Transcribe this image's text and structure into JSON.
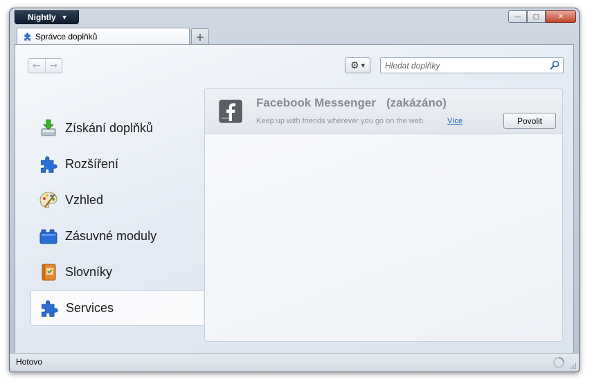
{
  "window": {
    "app_menu_label": "Nightly",
    "controls": {
      "minimize": "—",
      "maximize": "▢",
      "close": "✕"
    }
  },
  "tabs": [
    {
      "label": "Správce doplňků"
    }
  ],
  "newtab_label": "+",
  "toolbar": {
    "back_symbol": "←",
    "forward_symbol": "→",
    "gear_symbol": "⚙",
    "gear_dropdown_symbol": "▼",
    "search_placeholder": "Hledat doplňky"
  },
  "categories": [
    {
      "label": "Získání doplňků",
      "icon": "download-icon",
      "selected": false
    },
    {
      "label": "Rozšíření",
      "icon": "puzzle-icon",
      "selected": false
    },
    {
      "label": "Vzhled",
      "icon": "palette-icon",
      "selected": false
    },
    {
      "label": "Zásuvné moduly",
      "icon": "plugin-block-icon",
      "selected": false
    },
    {
      "label": "Slovníky",
      "icon": "dictionary-icon",
      "selected": false
    },
    {
      "label": "Services",
      "icon": "puzzle-icon",
      "selected": true
    }
  ],
  "addon": {
    "name": "Facebook Messenger",
    "status": "(zakázáno)",
    "description": "Keep up with friends wherever you go on the web.",
    "more_link": "Více",
    "enable_button": "Povolit",
    "icon": "facebook-icon"
  },
  "statusbar": {
    "text": "Hotovo"
  },
  "colors": {
    "accent_blue": "#1a5ec4",
    "puzzle_blue": "#2a6fd6",
    "disabled_text": "#858b93"
  }
}
